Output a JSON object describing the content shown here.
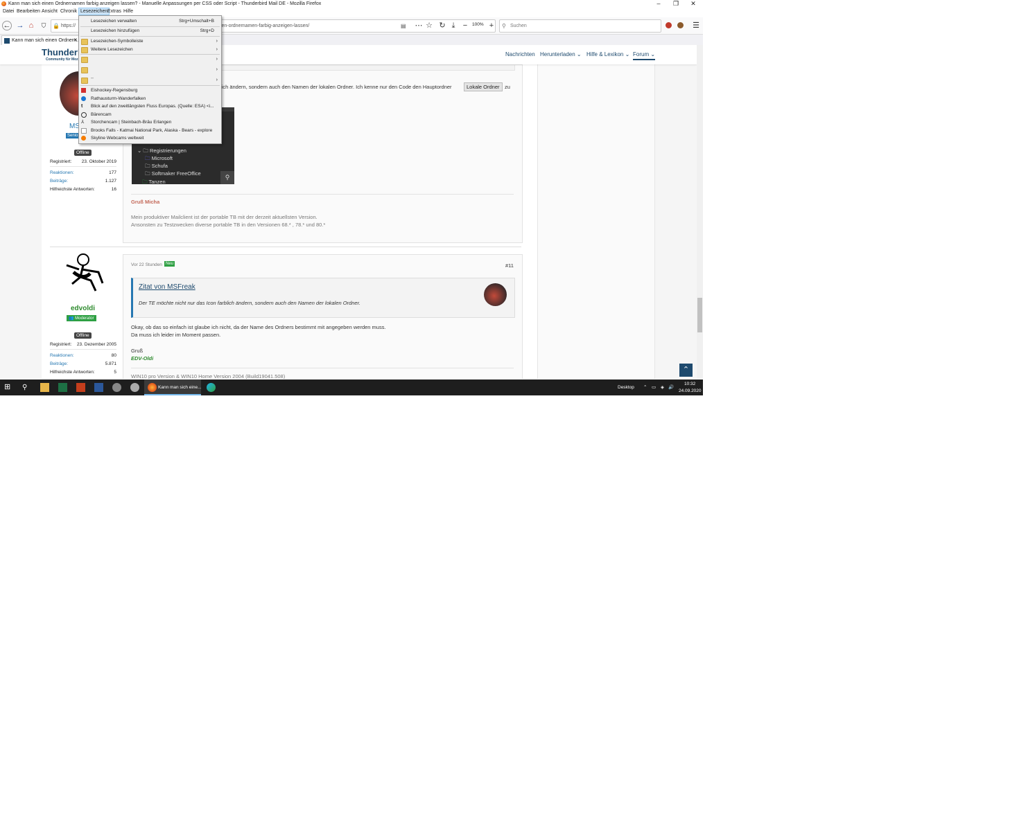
{
  "window": {
    "title": "Kann man sich einen Ordnernamen farbig anzeigen lassen? - Manuelle Anpassungen per CSS oder Script - Thunderbird Mail DE - Mozilla Firefox",
    "controls": {
      "minimize": "–",
      "maximize": "❐",
      "close": "✕"
    }
  },
  "menubar": [
    "Datei",
    "Bearbeiten",
    "Ansicht",
    "Chronik",
    "Lesezeichen",
    "Extras",
    "Hilfe"
  ],
  "navbar": {
    "url_visible_start": "https://",
    "url_visible_end": "inen-ordnernamen-farbig-anzeigen-lassen/",
    "zoom": "100%",
    "search_placeholder": "Suchen"
  },
  "tab": {
    "title": "Kann man sich einen Ordnern..."
  },
  "site": {
    "logo": "Thunderl",
    "logo_sub": "Community für Mozi",
    "nav": [
      "Nachrichten",
      "Herunterladen",
      "Hilfe & Lexikon",
      "Forum"
    ]
  },
  "post10": {
    "username_partial": "MS",
    "badge_partial": "Senio",
    "status": "Offline",
    "stats": [
      {
        "k": "Registriert:",
        "v": "23. Oktober 2019"
      },
      {
        "k": "Reaktionen:",
        "v": "177"
      },
      {
        "k": "Beiträge:",
        "v": "1.127"
      },
      {
        "k": "Hilfreichste Antworten:",
        "v": "16"
      }
    ],
    "text_line": "lich ändern, sondern auch den Namen der lokalen Ordner. Ich kenne nur den Code den Hauptordner",
    "code_button": "Lokale Ordner",
    "text_after": "zu",
    "tree": [
      "Registrierungen",
      "Microsoft",
      "Schufa",
      "Softmaker FreeOffice",
      "Tanzen"
    ],
    "signature_greet": "Gruß Micha",
    "signature_l1": "Mein produktiver Mailclient ist der portable TB mit der derzeit aktuellsten Version.",
    "signature_l2": "Ansonsten zu Testzwecken diverse portable TB in den Versionen 68.* , 78.* und 80.*"
  },
  "post11": {
    "username": "edvoldi",
    "role": "Moderator",
    "status": "Offline",
    "stats": [
      {
        "k": "Registriert:",
        "v": "23. Dezember 2005"
      },
      {
        "k": "Reaktionen:",
        "v": "80"
      },
      {
        "k": "Beiträge:",
        "v": "5.871"
      },
      {
        "k": "Hilfreichste Antworten:",
        "v": "5"
      }
    ],
    "time": "Vor 22 Stunden",
    "new_badge": "Neu",
    "number": "#11",
    "quote_title": "Zitat von MSFreak",
    "quote_text": "Der TE möchte nicht nur das Icon farblich ändern, sondern auch den Namen der lokalen Ordner.",
    "body_l1": "Okay, ob das so einfach ist glaube ich nicht, da der Name des Ordners bestimmt mit angegeben werden muss.",
    "body_l2": "Da muss ich leider im Moment passen.",
    "greet": "Gruß",
    "sig_name": "EDV-Oldi",
    "sig_line": "WIN10 pro Version & WIN10 Home Version 2004 (Build19041.508)"
  },
  "bookmarks_menu": {
    "manage": {
      "label": "Lesezeichen verwalten",
      "shortcut": "Strg+Umschalt+B"
    },
    "add": {
      "label": "Lesezeichen hinzufügen",
      "shortcut": "Strg+D"
    },
    "folders": [
      "Lesezeichen-Symbolleiste",
      "Weitere Lesezeichen"
    ],
    "redacted_folders": [
      "",
      "",
      "¨¨"
    ],
    "items": [
      "Eishockey-Regensburg",
      "Rathausturm-Wanderfalken",
      "Blick auf den zweitlängsten Fluss Europas. (Quelle: ESA) <i...",
      "Bärencam",
      "Storchencam | Steinbach-Bräu Erlangen",
      "Brooks Falls - Katmai National Park, Alaska - Bears - explore",
      "Skyline Webcams weltweit"
    ]
  },
  "taskbar": {
    "active_task": "Kann man sich eine...",
    "desktop": "Desktop",
    "time": "10:32",
    "date": "24.09.2020"
  }
}
